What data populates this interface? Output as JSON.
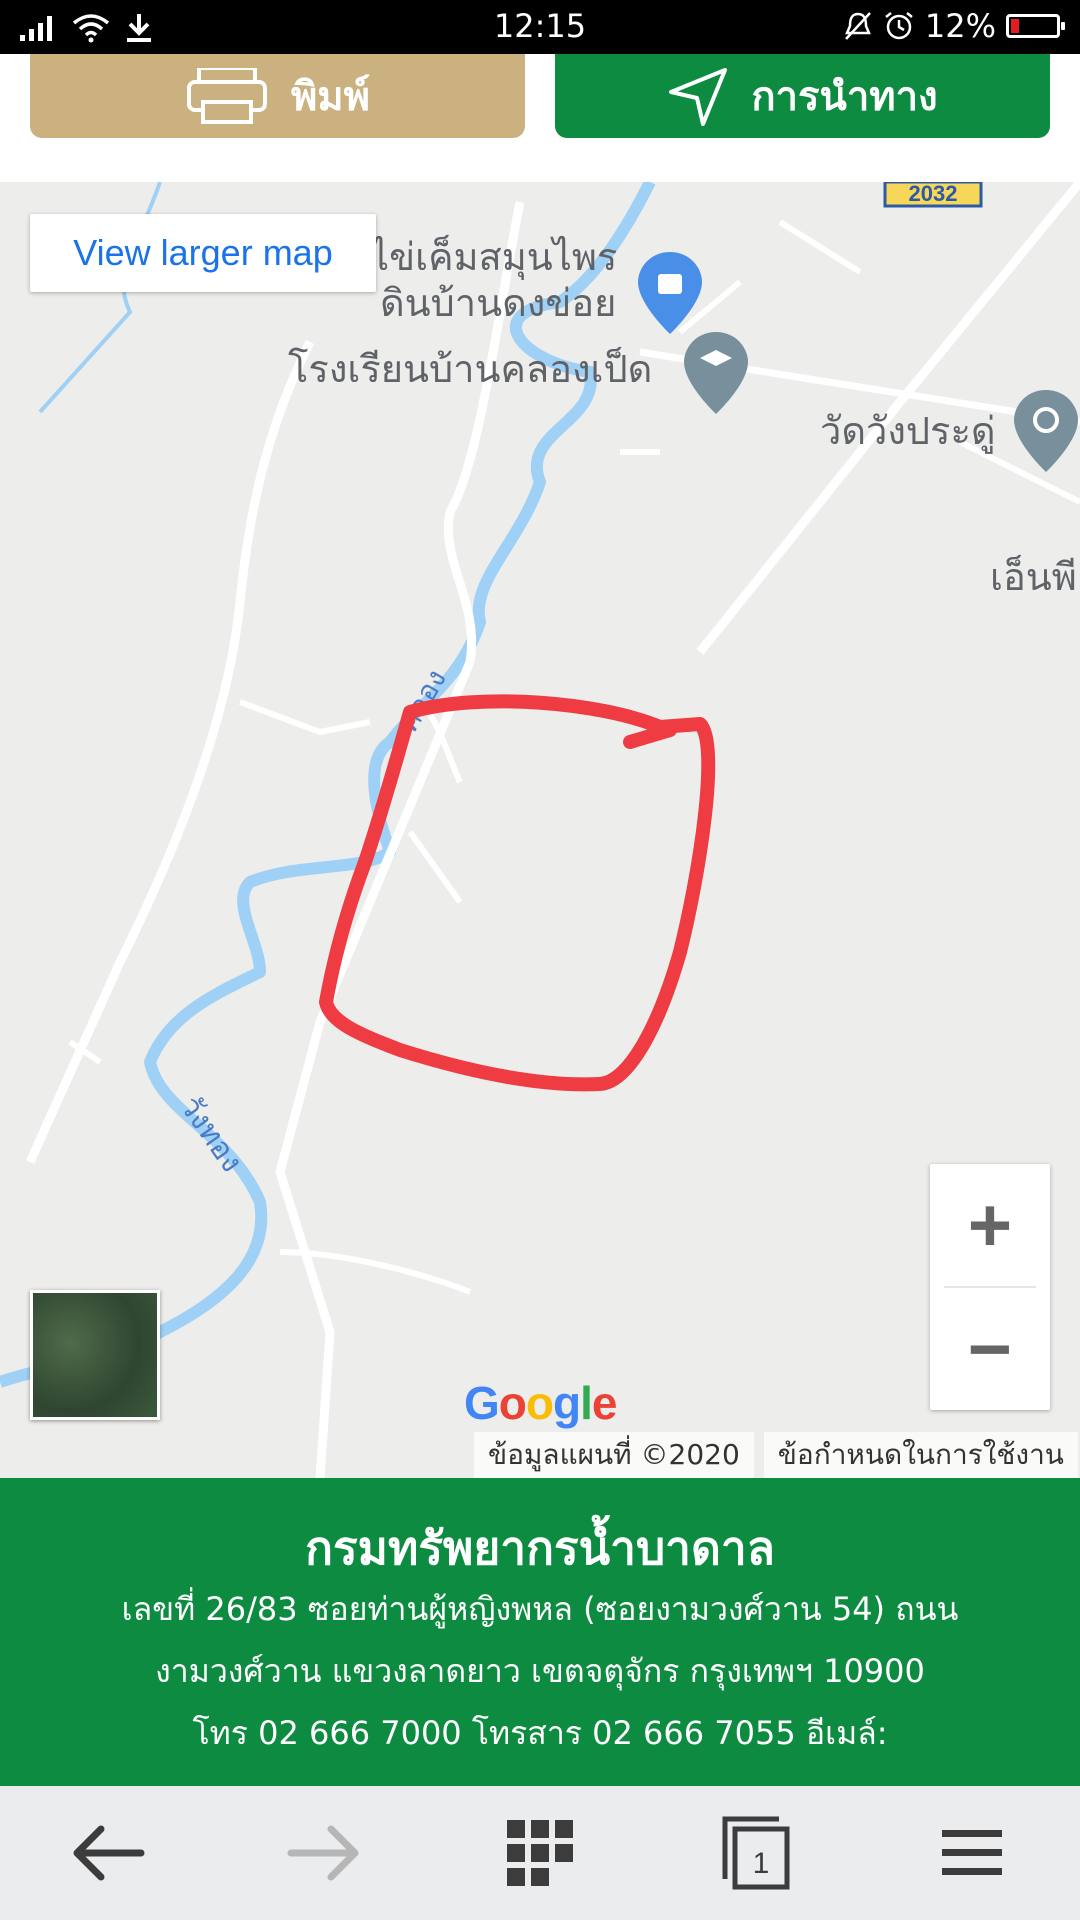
{
  "status_bar": {
    "time": "12:15",
    "battery": "12%",
    "icons": [
      "signal-icon",
      "wifi-icon",
      "download-icon",
      "mute-icon",
      "alarm-icon",
      "battery-icon"
    ],
    "battery_color": "#e31b23"
  },
  "actions": {
    "print_label": "พิมพ์",
    "navigate_label": "การนำทาง",
    "print_color": "#cbb080",
    "navigate_color": "#0d8c41"
  },
  "map": {
    "view_larger": "View larger map",
    "road_shield": "2032",
    "labels": {
      "shop": "ไข่เค็มสมุนไพร",
      "shop2": "ดินบ้านดงข่อย",
      "school": "โรงเรียนบ้านคลองเป็ด",
      "temple": "วัดวังประดู่",
      "edge": "เอ็นพี",
      "canal": "คลอง",
      "river": "วังทอง"
    },
    "zoom_in": "+",
    "zoom_out": "−",
    "google": "Google",
    "attribution": "ข้อมูลแผนที่ ©2020",
    "terms": "ข้อกำหนดในการใช้งาน"
  },
  "footer": {
    "org": "กรมทรัพยากรน้ำบาดาล",
    "address1": "เลขที่ 26/83 ซอยท่านผู้หญิงพหล (ซอยงามวงศ์วาน 54) ถนน",
    "address2": "งามวงศ์วาน แขวงลาดยาว เขตจตุจักร กรุงเทพฯ 10900",
    "contact": "โทร 02 666 7000 โทรสาร 02 666 7055 อีเมล์:",
    "color": "#0d8c41"
  },
  "browser_nav": {
    "tabs_count": "1",
    "icons": [
      "back-arrow-icon",
      "forward-arrow-icon",
      "apps-grid-icon",
      "tabs-icon",
      "menu-icon"
    ]
  }
}
